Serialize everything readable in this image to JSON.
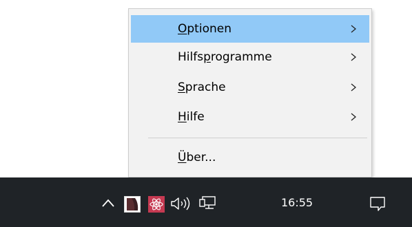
{
  "context_menu": {
    "items": [
      {
        "label_prefix": "",
        "mnemonic": "O",
        "label_suffix": "ptionen",
        "has_submenu": true,
        "highlighted": true
      },
      {
        "label_prefix": "Hilfs",
        "mnemonic": "p",
        "label_suffix": "rogramme",
        "has_submenu": true,
        "highlighted": false
      },
      {
        "label_prefix": "",
        "mnemonic": "S",
        "label_suffix": "prache",
        "has_submenu": true,
        "highlighted": false
      },
      {
        "label_prefix": "",
        "mnemonic": "H",
        "label_suffix": "ilfe",
        "has_submenu": true,
        "highlighted": false
      },
      {
        "label_prefix": "",
        "mnemonic": "Ü",
        "label_suffix": "ber...",
        "has_submenu": false,
        "highlighted": false
      }
    ],
    "submenu_icon": "chevron-right-icon",
    "highlight_color": "#91c9f7"
  },
  "taskbar": {
    "background": "#1f2327",
    "tray_icons": [
      "show-hidden-icons-chevron-icon",
      "app-tray-icon",
      "atom-tray-icon",
      "volume-icon",
      "network-icon"
    ],
    "clock": "16:55",
    "notification_icon": "action-center-icon"
  }
}
